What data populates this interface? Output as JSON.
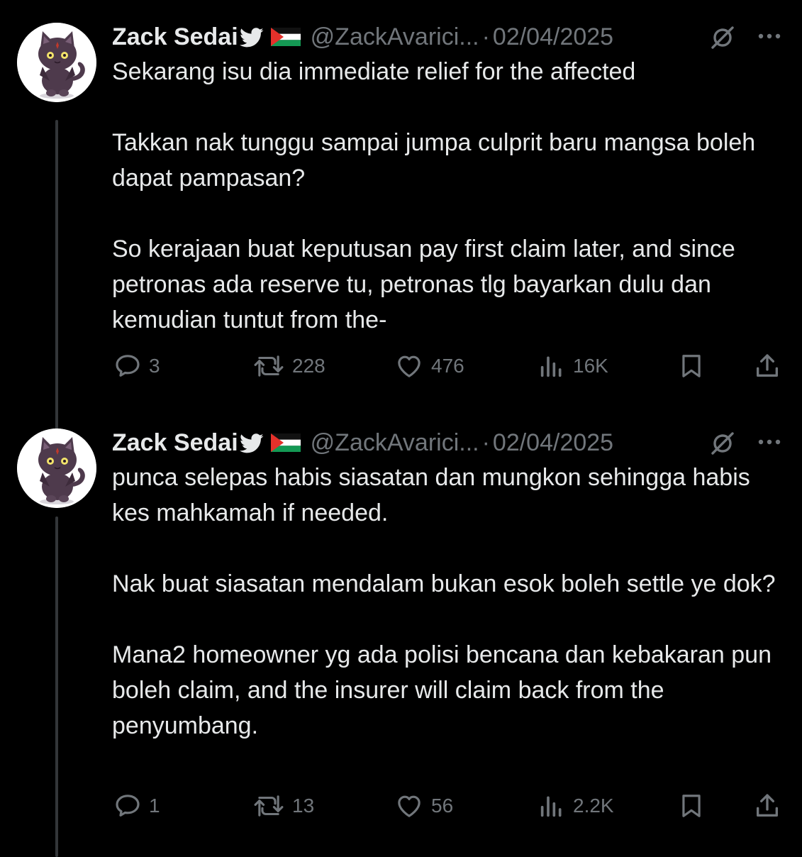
{
  "tweets": [
    {
      "author_name": "Zack Sedai",
      "handle": "@ZackAvarici...",
      "separator": "·",
      "date": "02/04/2025",
      "paragraphs": [
        "Sekarang isu dia immediate relief for the affected",
        "Takkan nak tunggu sampai jumpa culprit baru mangsa boleh dapat pampasan?",
        "So kerajaan buat keputusan pay first claim later, and since petronas ada reserve tu, petronas tlg bayarkan dulu dan kemudian tuntut from the-"
      ],
      "replies": "3",
      "reposts": "228",
      "likes": "476",
      "views": "16K",
      "icons": {
        "reply": "reply-icon",
        "repost": "repost-icon",
        "like": "heart-icon",
        "views": "views-icon",
        "bookmark": "bookmark-icon",
        "share": "share-icon"
      }
    },
    {
      "author_name": "Zack Sedai",
      "handle": "@ZackAvarici...",
      "separator": "·",
      "date": "02/04/2025",
      "paragraphs": [
        "punca selepas habis siasatan dan mungkon sehingga habis kes mahkamah if needed.",
        "Nak buat siasatan mendalam bukan esok boleh settle ye dok?",
        "Mana2 homeowner yg ada polisi bencana dan kebakaran pun boleh claim, and the insurer will claim back from the penyumbang."
      ],
      "replies": "1",
      "reposts": "13",
      "likes": "56",
      "views": "2.2K",
      "icons": {
        "reply": "reply-icon",
        "repost": "repost-icon",
        "like": "heart-icon",
        "views": "views-icon",
        "bookmark": "bookmark-icon",
        "share": "share-icon"
      }
    }
  ],
  "colors": {
    "background": "#000000",
    "text_primary": "#e7e9ea",
    "text_secondary": "#71767b",
    "thread_line": "#333639"
  }
}
